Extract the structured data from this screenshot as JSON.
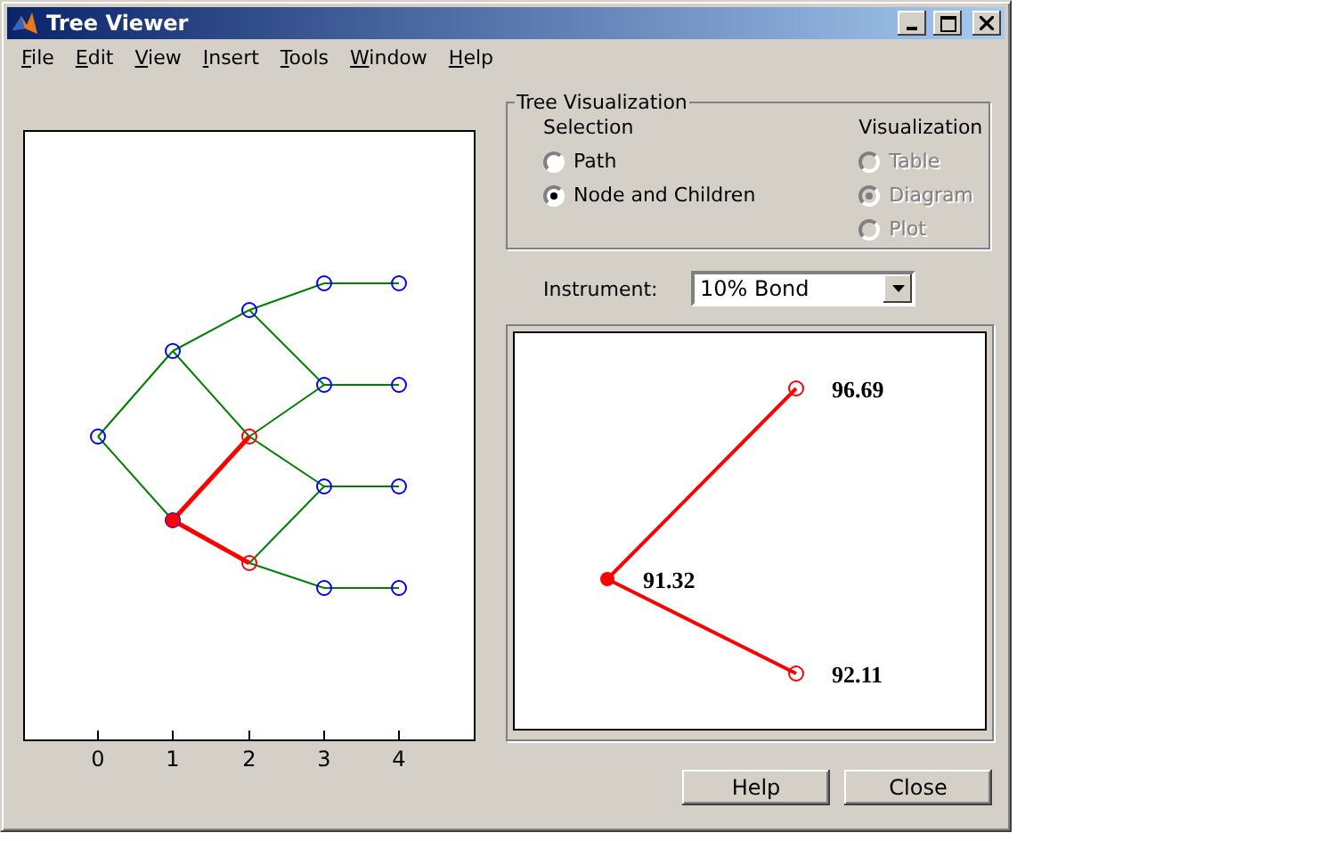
{
  "window": {
    "title": "Tree Viewer"
  },
  "menu": [
    "File",
    "Edit",
    "View",
    "Insert",
    "Tools",
    "Window",
    "Help"
  ],
  "tree_plot": {
    "xticks": [
      "0",
      "1",
      "2",
      "3",
      "4"
    ]
  },
  "tree_visualization": {
    "title": "Tree Visualization",
    "selection": {
      "label": "Selection",
      "options": [
        {
          "label": "Path",
          "selected": false,
          "disabled": false
        },
        {
          "label": "Node and Children",
          "selected": true,
          "disabled": false
        }
      ]
    },
    "visualization": {
      "label": "Visualization",
      "options": [
        {
          "label": "Table",
          "selected": false,
          "disabled": true
        },
        {
          "label": "Diagram",
          "selected": true,
          "disabled": true
        },
        {
          "label": "Plot",
          "selected": false,
          "disabled": true
        }
      ]
    }
  },
  "instrument": {
    "label": "Instrument:",
    "value": "10% Bond"
  },
  "diagram": {
    "nodes": [
      {
        "value": "96.69",
        "kind": "up"
      },
      {
        "value": "91.32",
        "kind": "root"
      },
      {
        "value": "92.11",
        "kind": "down"
      }
    ]
  },
  "buttons": [
    "Help",
    "Close"
  ]
}
